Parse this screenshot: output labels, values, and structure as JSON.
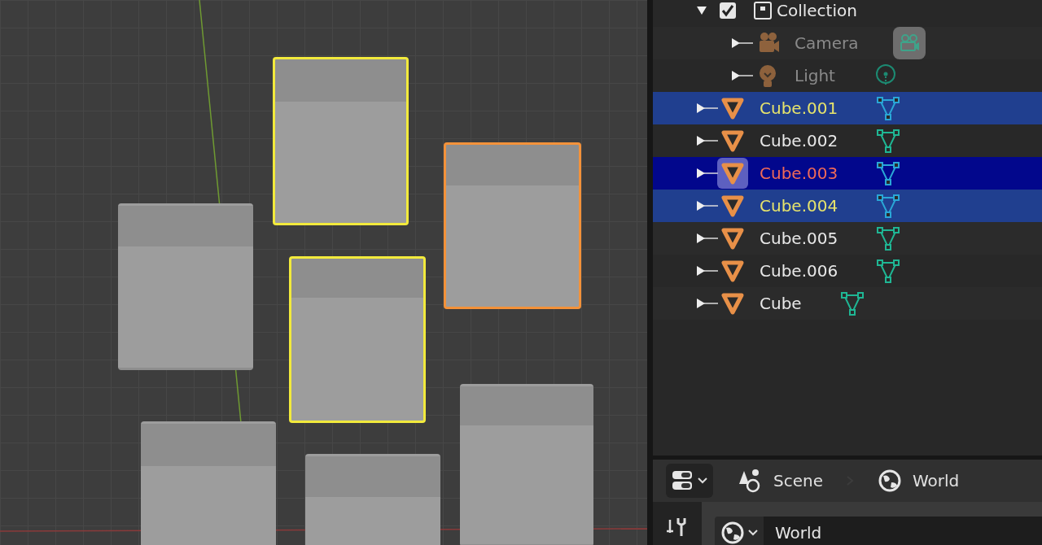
{
  "viewport": {
    "objects": [
      {
        "selected": true,
        "active": false
      },
      {
        "selected": true,
        "active": true
      },
      {
        "selected": false,
        "active": false
      },
      {
        "selected": true,
        "active": false
      },
      {
        "selected": false,
        "active": false
      },
      {
        "selected": false,
        "active": false
      },
      {
        "selected": false,
        "active": false
      }
    ]
  },
  "outliner": {
    "items": [
      {
        "kind": "collection",
        "name": "Collection",
        "expanded": true,
        "checked": true,
        "selected": false,
        "active": false,
        "dimmed": false,
        "children": [
          {
            "kind": "camera",
            "name": "Camera",
            "expanded": false,
            "selected": false,
            "active": false,
            "dimmed": true,
            "data_highlighted": true
          },
          {
            "kind": "light",
            "name": "Light",
            "expanded": false,
            "selected": false,
            "active": false,
            "dimmed": true,
            "data_highlighted": false
          }
        ]
      },
      {
        "kind": "mesh",
        "name": "Cube.001",
        "expanded": false,
        "selected": true,
        "active": false,
        "dimmed": false,
        "data_highlighted": false
      },
      {
        "kind": "mesh",
        "name": "Cube.002",
        "expanded": false,
        "selected": false,
        "active": false,
        "dimmed": false,
        "data_highlighted": false
      },
      {
        "kind": "mesh",
        "name": "Cube.003",
        "expanded": false,
        "selected": true,
        "active": true,
        "dimmed": false,
        "data_highlighted": false
      },
      {
        "kind": "mesh",
        "name": "Cube.004",
        "expanded": false,
        "selected": true,
        "active": false,
        "dimmed": false,
        "data_highlighted": false
      },
      {
        "kind": "mesh",
        "name": "Cube.005",
        "expanded": false,
        "selected": false,
        "active": false,
        "dimmed": false,
        "data_highlighted": false
      },
      {
        "kind": "mesh",
        "name": "Cube.006",
        "expanded": false,
        "selected": false,
        "active": false,
        "dimmed": false,
        "data_highlighted": false
      },
      {
        "kind": "mesh",
        "name": "Cube",
        "expanded": false,
        "selected": false,
        "active": false,
        "dimmed": false,
        "data_highlighted": false
      }
    ]
  },
  "properties": {
    "breadcrumb": [
      {
        "kind": "scene",
        "label": "Scene"
      },
      {
        "kind": "world",
        "label": "World"
      }
    ],
    "world_field": {
      "value": "World"
    }
  }
}
